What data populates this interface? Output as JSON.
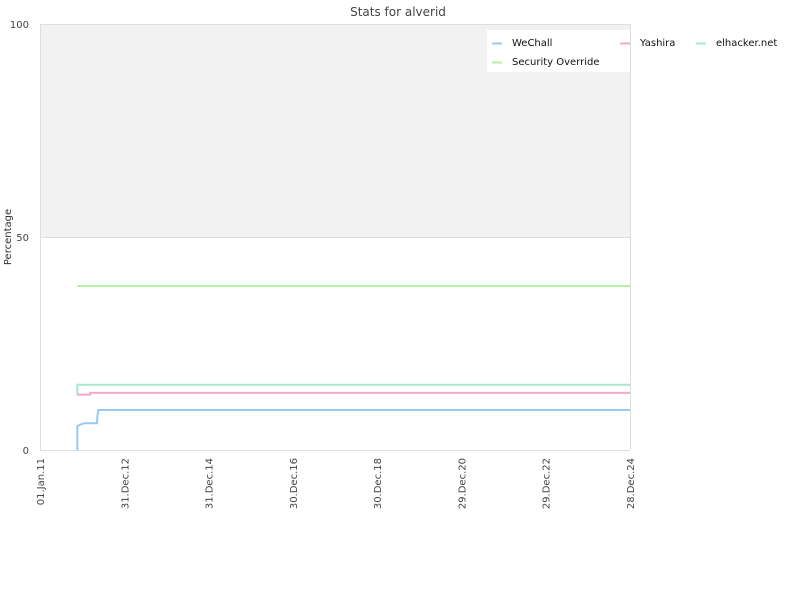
{
  "chart_data": {
    "type": "line",
    "title": "Stats for alverid",
    "xlabel": "",
    "ylabel": "Percentage",
    "ylim": [
      0,
      100
    ],
    "yticks": [
      0,
      50,
      100
    ],
    "xlim": [
      "2011-01-01",
      "2024-12-28"
    ],
    "xticks": [
      {
        "date": "2011-01-01",
        "label": "01.Jan.11"
      },
      {
        "date": "2012-12-31",
        "label": "31.Dec.12"
      },
      {
        "date": "2014-12-31",
        "label": "31.Dec.14"
      },
      {
        "date": "2016-12-30",
        "label": "30.Dec.16"
      },
      {
        "date": "2018-12-30",
        "label": "30.Dec.18"
      },
      {
        "date": "2020-12-29",
        "label": "29.Dec.20"
      },
      {
        "date": "2022-12-29",
        "label": "29.Dec.22"
      },
      {
        "date": "2024-12-28",
        "label": "28.Dec.24"
      }
    ],
    "grid": true,
    "legend_position": "top-right",
    "series": [
      {
        "name": "WeChall",
        "color": "#99c8f2",
        "points": [
          [
            "2011-11-20",
            0
          ],
          [
            "2011-11-20",
            5.6
          ],
          [
            "2011-12-20",
            6.0
          ],
          [
            "2012-01-20",
            6.3
          ],
          [
            "2012-05-10",
            6.3
          ],
          [
            "2012-05-10",
            7.5
          ],
          [
            "2012-05-20",
            9.4
          ],
          [
            "2024-12-28",
            9.4
          ]
        ]
      },
      {
        "name": "Yashira",
        "color": "#f2a8cc",
        "points": [
          [
            "2011-11-15",
            13.0
          ],
          [
            "2012-03-10",
            13.0
          ],
          [
            "2012-03-10",
            13.4
          ],
          [
            "2024-12-28",
            13.4
          ]
        ]
      },
      {
        "name": "elhacker.net",
        "color": "#a8e8cc",
        "points": [
          [
            "2011-11-20",
            13.0
          ],
          [
            "2011-11-20",
            15.3
          ],
          [
            "2024-12-28",
            15.3
          ]
        ]
      },
      {
        "name": "Security Override",
        "color": "#b4f0a8",
        "points": [
          [
            "2011-11-20",
            38.5
          ],
          [
            "2024-12-28",
            38.5
          ]
        ]
      }
    ]
  }
}
